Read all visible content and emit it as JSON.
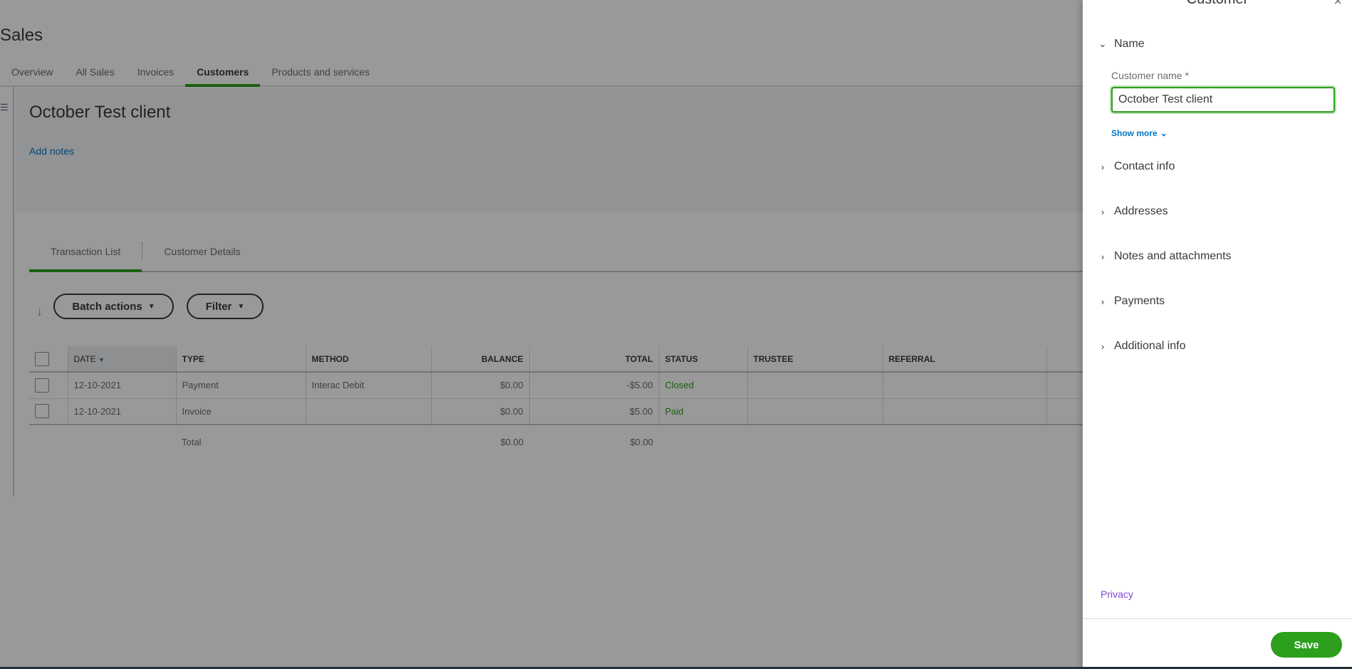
{
  "page": {
    "title": "Sales",
    "tabs": [
      {
        "label": "Overview",
        "active": false
      },
      {
        "label": "All Sales",
        "active": false
      },
      {
        "label": "Invoices",
        "active": false
      },
      {
        "label": "Customers",
        "active": true
      },
      {
        "label": "Products and services",
        "active": false
      }
    ]
  },
  "customer": {
    "name": "October Test client",
    "add_notes_label": "Add notes",
    "subtabs": [
      {
        "label": "Transaction List",
        "active": true
      },
      {
        "label": "Customer Details",
        "active": false
      }
    ]
  },
  "toolbar": {
    "batch_actions_label": "Batch actions",
    "filter_label": "Filter",
    "caret": "▼"
  },
  "table": {
    "columns": [
      "DATE",
      "TYPE",
      "METHOD",
      "BALANCE",
      "TOTAL",
      "STATUS",
      "TRUSTEE",
      "REFERRAL"
    ],
    "sort_indicator": "▼",
    "rows": [
      {
        "date": "12-10-2021",
        "type": "Payment",
        "method": "Interac Debit",
        "balance": "$0.00",
        "total": "-$5.00",
        "status": "Closed",
        "trustee": "",
        "referral": ""
      },
      {
        "date": "12-10-2021",
        "type": "Invoice",
        "method": "",
        "balance": "$0.00",
        "total": "$5.00",
        "status": "Paid",
        "trustee": "",
        "referral": ""
      }
    ],
    "total_row": {
      "label": "Total",
      "balance": "$0.00",
      "total": "$0.00"
    }
  },
  "panel": {
    "title": "Customer",
    "close_icon": "×",
    "name_section": {
      "label": "Name",
      "expanded": true,
      "field_label": "Customer name *",
      "field_value": "October Test client",
      "show_more_label": "Show more"
    },
    "sections": [
      {
        "label": "Contact info"
      },
      {
        "label": "Addresses"
      },
      {
        "label": "Notes and attachments"
      },
      {
        "label": "Payments"
      },
      {
        "label": "Additional info"
      }
    ],
    "privacy_label": "Privacy",
    "save_label": "Save"
  },
  "colors": {
    "accent_green": "#2ca01c",
    "link_blue": "#0077c5",
    "privacy_purple": "#8046d6"
  }
}
